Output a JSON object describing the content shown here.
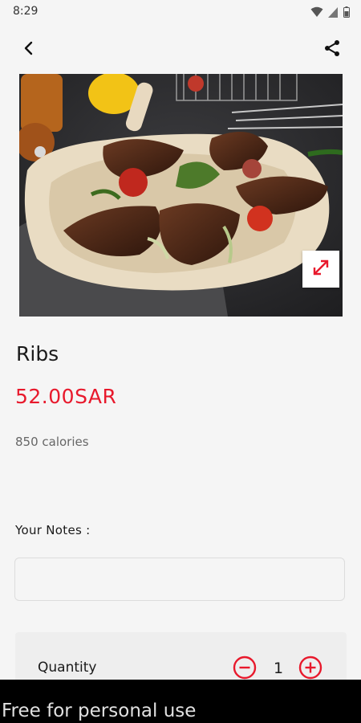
{
  "status_bar": {
    "time": "8:29",
    "icons": [
      "wifi-icon",
      "signal-icon",
      "battery-icon"
    ]
  },
  "app_bar": {
    "back_icon": "back-arrow-icon",
    "share_icon": "share-icon"
  },
  "product": {
    "image_alt": "Grilled ribs on flatbread",
    "name": "Ribs",
    "price": "52.00SAR",
    "calories": "850 calories"
  },
  "notes": {
    "label": "Your Notes :",
    "value": "",
    "placeholder": ""
  },
  "quantity": {
    "label": "Quantity",
    "value": "1"
  },
  "watermark": {
    "text": "Free for personal use"
  },
  "colors": {
    "accent": "#e8192c",
    "background": "#f5f5f5",
    "text": "#1a1a1a"
  }
}
